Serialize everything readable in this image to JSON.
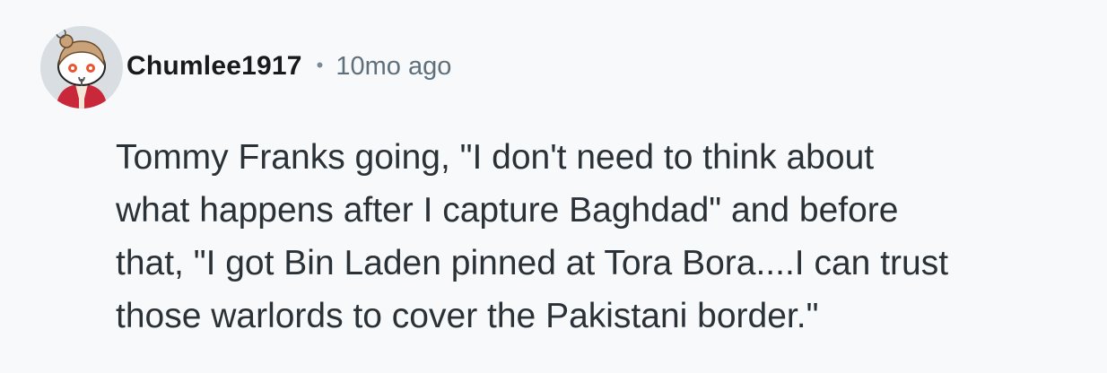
{
  "comment": {
    "username": "Chumlee1917",
    "separator": "•",
    "timestamp": "10mo ago",
    "avatar_icon": "snoo-avatar-icon",
    "body_lines": [
      "Tommy Franks going, \"I don't need to think about",
      "what happens after I capture Baghdad\" and before",
      "that, \"I got Bin Laden pinned at Tora Bora....I can trust",
      "those warlords to cover the Pakistani border.\""
    ]
  },
  "colors": {
    "background": "#f7f9fa",
    "username": "#1a1a1b",
    "meta": "#5f6f7c",
    "body": "#2a3137"
  }
}
